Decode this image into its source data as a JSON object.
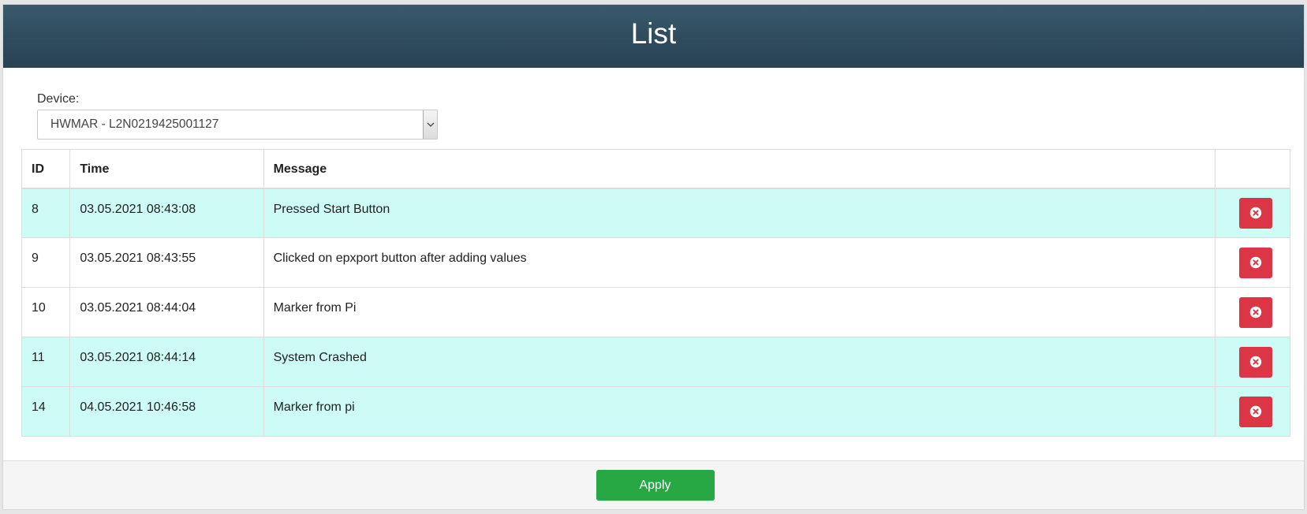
{
  "header": {
    "title": "List"
  },
  "device": {
    "label": "Device:",
    "selected": "HWMAR - L2N0219425001127"
  },
  "table": {
    "columns": [
      "ID",
      "Time",
      "Message",
      ""
    ],
    "rows": [
      {
        "id": "8",
        "time": "03.05.2021 08:43:08",
        "message": "Pressed Start Button",
        "highlighted": true
      },
      {
        "id": "9",
        "time": "03.05.2021 08:43:55",
        "message": "Clicked on epxport button after adding values",
        "highlighted": false
      },
      {
        "id": "10",
        "time": "03.05.2021 08:44:04",
        "message": "Marker from Pi",
        "highlighted": false
      },
      {
        "id": "11",
        "time": "03.05.2021 08:44:14",
        "message": "System Crashed",
        "highlighted": true
      },
      {
        "id": "14",
        "time": "04.05.2021 10:46:58",
        "message": "Marker from pi",
        "highlighted": true
      }
    ],
    "row_action_icon": "delete-circle-x-icon"
  },
  "footer": {
    "apply_label": "Apply"
  },
  "colors": {
    "header_bg": "#2e4a5c",
    "highlight_row": "#ccfcf5",
    "delete_button": "#dc3545",
    "apply_button": "#28a745"
  }
}
